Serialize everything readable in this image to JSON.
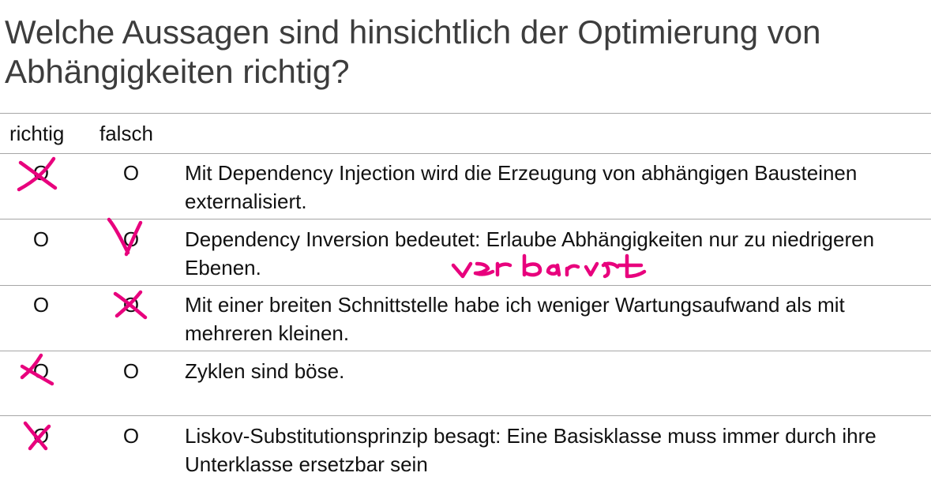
{
  "question": {
    "title": "Welche Aussagen sind hinsichtlich der Optimierung von Abhängigkeiten richtig?"
  },
  "header": {
    "richtig": "richtig",
    "falsch": "falsch"
  },
  "rows": [
    {
      "richtig_option": "O",
      "falsch_option": "O",
      "text": "Mit Dependency Injection wird die Erzeugung von abhängigen Bausteinen externalisiert.",
      "marked": "richtig"
    },
    {
      "richtig_option": "O",
      "falsch_option": "O",
      "text": "Dependency Inversion bedeutet: Erlaube Abhängigkeiten nur zu niedrigeren Ebenen.",
      "marked": "falsch",
      "annotation": "verkehrt"
    },
    {
      "richtig_option": "O",
      "falsch_option": "O",
      "text": "Mit einer breiten Schnittstelle habe ich weniger Wartungsaufwand als mit mehreren kleinen.",
      "marked": "falsch"
    },
    {
      "richtig_option": "O",
      "falsch_option": "O",
      "text": "Zyklen sind böse.",
      "marked": "richtig"
    },
    {
      "richtig_option": "O",
      "falsch_option": "O",
      "text": "Liskov-Substitutionsprinzip besagt: Eine Basisklasse muss immer durch ihre Unterklasse ersetzbar sein",
      "marked": "richtig"
    }
  ],
  "colors": {
    "ink": "#e8007d",
    "title": "#3d3d3d",
    "rule": "#a6a6a6"
  }
}
